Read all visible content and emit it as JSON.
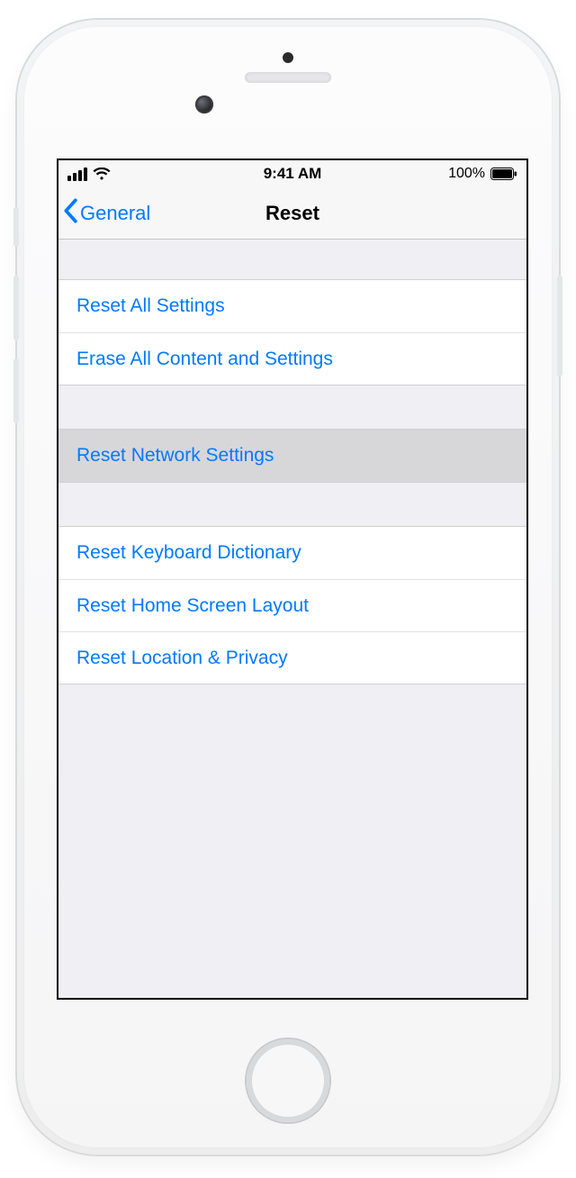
{
  "status_bar": {
    "time": "9:41 AM",
    "battery_pct": "100%"
  },
  "nav": {
    "back_label": "General",
    "title": "Reset"
  },
  "groups": {
    "top": {
      "reset_all": "Reset All Settings",
      "erase_all": "Erase All Content and Settings"
    },
    "network": {
      "reset_network": "Reset Network Settings"
    },
    "bottom": {
      "keyboard": "Reset Keyboard Dictionary",
      "home_layout": "Reset Home Screen Layout",
      "location_privacy": "Reset Location & Privacy"
    }
  }
}
